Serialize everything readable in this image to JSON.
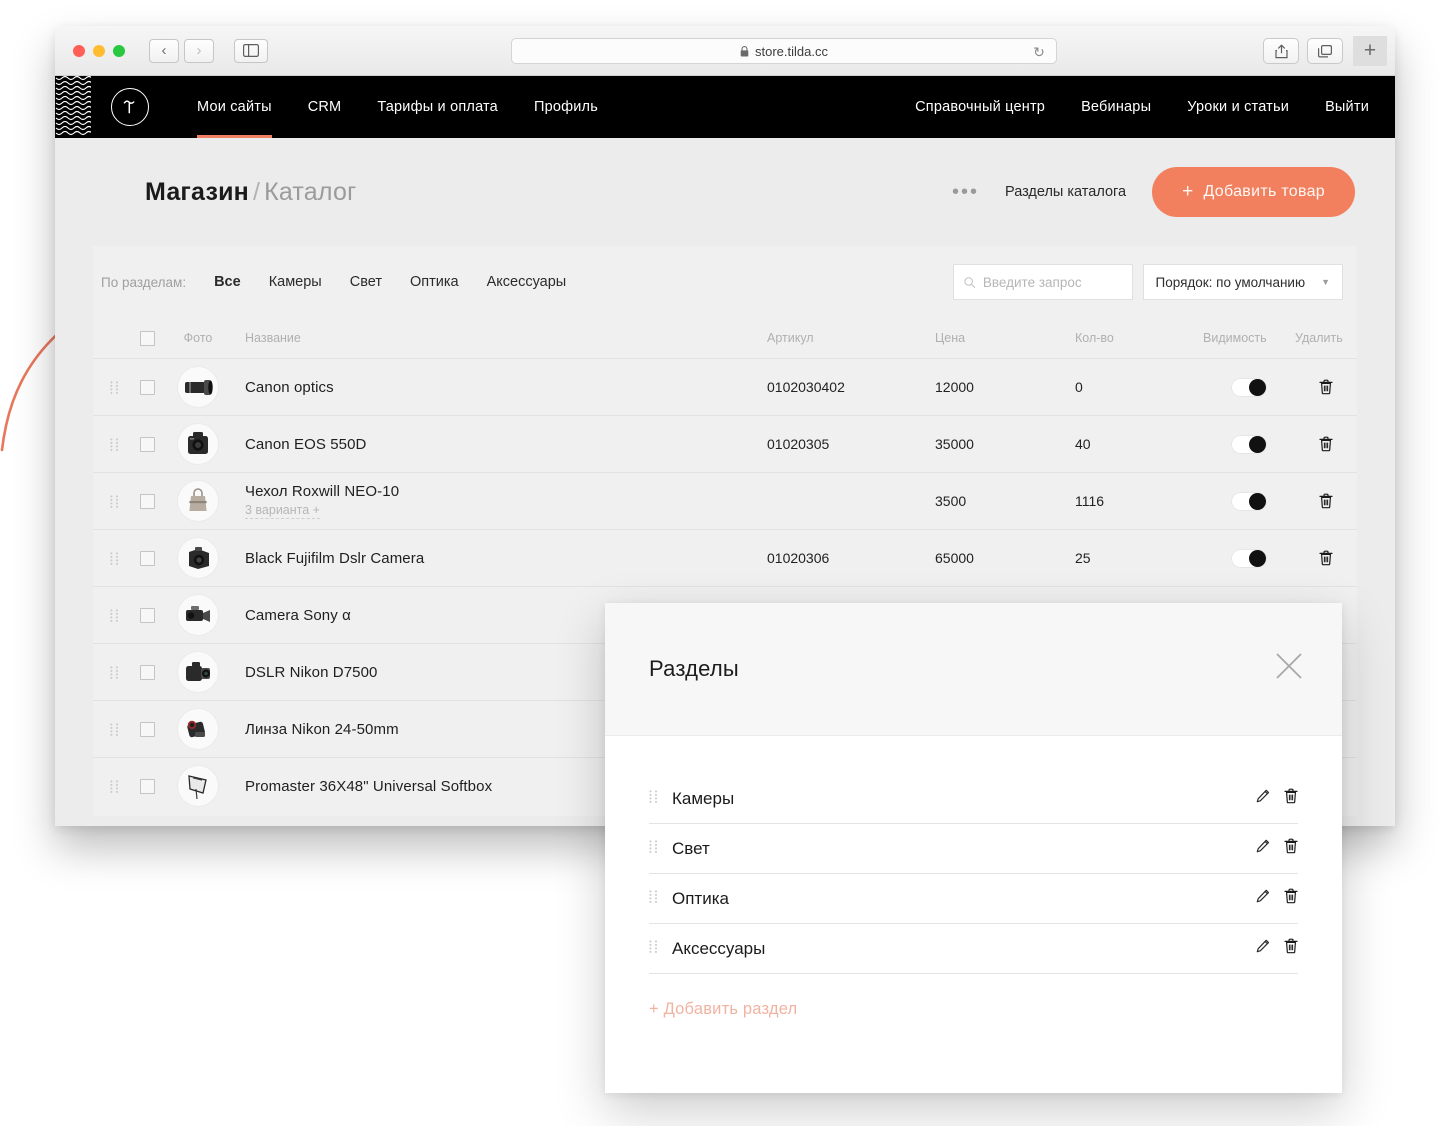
{
  "browser": {
    "url": "store.tilda.cc",
    "lock_icon": "lock-icon",
    "back_glyph": "‹",
    "forward_glyph": "›",
    "reload_glyph": "↻",
    "new_tab_glyph": "+"
  },
  "topnav": {
    "logo": "tilda-logo",
    "left_links": [
      {
        "label": "Мои сайты",
        "active": true
      },
      {
        "label": "CRM",
        "active": false
      },
      {
        "label": "Тарифы и оплата",
        "active": false
      },
      {
        "label": "Профиль",
        "active": false
      }
    ],
    "right_links": [
      {
        "label": "Справочный центр"
      },
      {
        "label": "Вебинары"
      },
      {
        "label": "Уроки и статьи"
      },
      {
        "label": "Выйти"
      }
    ],
    "accent": "#ef8066",
    "background": "#000000"
  },
  "header": {
    "breadcrumb_parent": "Магазин",
    "breadcrumb_sep": "/",
    "breadcrumb_current": "Каталог",
    "more_glyph": "•••",
    "sections_link": "Разделы каталога",
    "add_product_plus": "+",
    "add_product_label": "Добавить товар",
    "add_product_color": "#f2805f"
  },
  "toolbar": {
    "by_sections_label": "По разделам:",
    "chips": [
      {
        "label": "Все",
        "selected": true
      },
      {
        "label": "Камеры",
        "selected": false
      },
      {
        "label": "Свет",
        "selected": false
      },
      {
        "label": "Оптика",
        "selected": false
      },
      {
        "label": "Аксессуары",
        "selected": false
      }
    ],
    "search_placeholder": "Введите запрос",
    "search_value": "",
    "sort_label": "Порядок: по умолчанию",
    "sort_caret": "▼"
  },
  "table": {
    "columns": {
      "photo": "Фото",
      "name": "Название",
      "article": "Артикул",
      "price": "Цена",
      "qty": "Кол-во",
      "visibility": "Видимость",
      "delete": "Удалить"
    },
    "rows": [
      {
        "name": "Canon optics",
        "sub": "",
        "article": "0102030402",
        "price": "12000",
        "qty": "0",
        "visible": true,
        "thumb": "lens"
      },
      {
        "name": "Canon EOS 550D",
        "sub": "",
        "article": "01020305",
        "price": "35000",
        "qty": "40",
        "visible": true,
        "thumb": "dslr-front"
      },
      {
        "name": "Чехол Roxwill NEO-10",
        "sub": "3 варианта +",
        "article": "",
        "price": "3500",
        "qty": "1116",
        "visible": true,
        "thumb": "bag"
      },
      {
        "name": "Black Fujifilm Dslr Camera",
        "sub": "",
        "article": "01020306",
        "price": "65000",
        "qty": "25",
        "visible": true,
        "thumb": "dslr-angle"
      },
      {
        "name": "Camera Sony α",
        "sub": "",
        "article": "",
        "price": "",
        "qty": "",
        "visible": true,
        "thumb": "camcorder"
      },
      {
        "name": "DSLR Nikon D7500",
        "sub": "",
        "article": "",
        "price": "",
        "qty": "",
        "visible": true,
        "thumb": "dslr-side"
      },
      {
        "name": "Линза Nikon 24-50mm",
        "sub": "",
        "article": "",
        "price": "",
        "qty": "",
        "visible": true,
        "thumb": "lens-red"
      },
      {
        "name": "Promaster 36X48\" Universal Softbox",
        "sub": "",
        "article": "",
        "price": "",
        "qty": "",
        "visible": true,
        "thumb": "softbox"
      }
    ]
  },
  "modal": {
    "title": "Разделы",
    "close_glyph": "✕",
    "sections": [
      {
        "name": "Камеры"
      },
      {
        "name": "Свет"
      },
      {
        "name": "Оптика"
      },
      {
        "name": "Аксессуары"
      }
    ],
    "add_section_label": "+ Добавить раздел",
    "add_section_color": "#f0b3a1"
  },
  "annotation": {
    "arrow_color": "#e8775c"
  }
}
